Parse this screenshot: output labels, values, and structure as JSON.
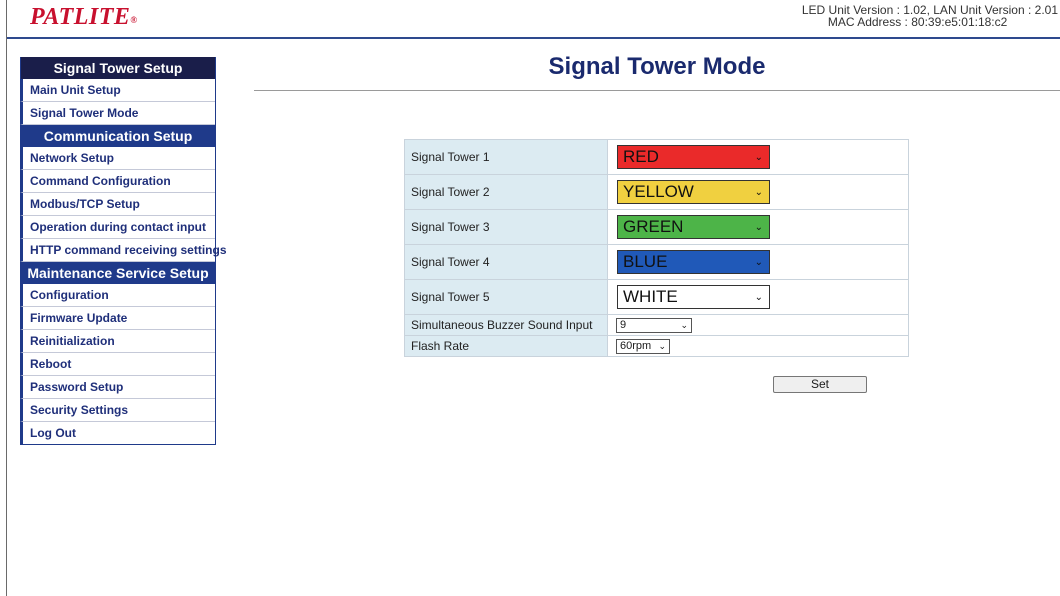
{
  "header": {
    "logo_text": "PATLITE",
    "logo_mark": "®",
    "version_line": "LED Unit Version : 1.02, LAN Unit Version : 2.01",
    "mac_line": "MAC Address : 80:39:e5:01:18:c2"
  },
  "sidebar": {
    "sections": [
      {
        "title": "Signal Tower Setup",
        "items": [
          "Main Unit Setup",
          "Signal Tower Mode"
        ]
      },
      {
        "title": "Communication Setup",
        "items": [
          "Network Setup",
          "Command Configuration",
          "Modbus/TCP Setup",
          "Operation during contact input",
          "HTTP command receiving settings"
        ]
      },
      {
        "title": "Maintenance Service Setup",
        "items": [
          "Configuration",
          "Firmware Update",
          "Reinitialization",
          "Reboot",
          "Password Setup",
          "Security Settings",
          "Log Out"
        ]
      }
    ]
  },
  "main": {
    "title": "Signal Tower Mode",
    "towers": [
      {
        "label": "Signal Tower 1",
        "value": "RED",
        "color": "#ea2a2a"
      },
      {
        "label": "Signal Tower 2",
        "value": "YELLOW",
        "color": "#f0d040"
      },
      {
        "label": "Signal Tower 3",
        "value": "GREEN",
        "color": "#4db448"
      },
      {
        "label": "Signal Tower 4",
        "value": "BLUE",
        "color": "#2059b8"
      },
      {
        "label": "Signal Tower 5",
        "value": "WHITE",
        "color": "#ffffff"
      }
    ],
    "buzzer": {
      "label": "Simultaneous Buzzer Sound Input",
      "value": "9"
    },
    "flash": {
      "label": "Flash Rate",
      "value": "60rpm"
    },
    "set_label": "Set"
  }
}
